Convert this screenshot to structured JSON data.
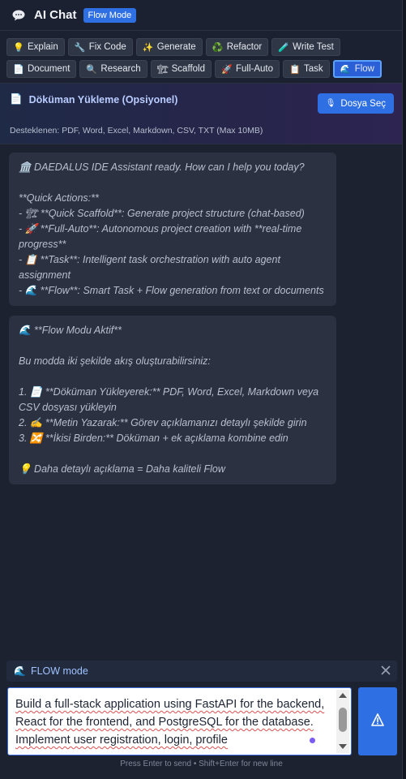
{
  "header": {
    "title": "AI Chat",
    "mode_badge": "Flow Mode",
    "icon": "chat-bubble-icon"
  },
  "toolbar": {
    "buttons": [
      {
        "icon": "💡",
        "label": "Explain"
      },
      {
        "icon": "🔧",
        "label": "Fix Code"
      },
      {
        "icon": "✨",
        "label": "Generate"
      },
      {
        "icon": "♻️",
        "label": "Refactor"
      },
      {
        "icon": "🧪",
        "label": "Write Test"
      },
      {
        "icon": "📄",
        "label": "Document"
      },
      {
        "icon": "🔍",
        "label": "Research"
      },
      {
        "icon": "🏗",
        "label": "Scaffold"
      },
      {
        "icon": "🚀",
        "label": "Full-Auto"
      },
      {
        "icon": "📋",
        "label": "Task"
      },
      {
        "icon": "🌊",
        "label": "Flow"
      }
    ],
    "active": "Flow"
  },
  "upload": {
    "icon": "📄",
    "title": "Döküman Yükleme (Opsiyonel)",
    "button_icon": "🎙",
    "button_label": "Dosya Seç",
    "supported": "Desteklenen: PDF, Word, Excel, Markdown, CSV, TXT (Max 10MB)"
  },
  "messages": [
    {
      "lines": [
        "🏛️ DAEDALUS IDE Assistant ready. How can I help you today?",
        "",
        "**Quick Actions:**",
        "- 🏗 **Quick Scaffold**: Generate project structure (chat-based)",
        "- 🚀 **Full-Auto**: Autonomous project creation with **real-time progress**",
        "- 📋 **Task**: Intelligent task orchestration with auto agent assignment",
        "- 🌊 **Flow**: Smart Task + Flow generation from text or documents"
      ]
    },
    {
      "lines": [
        "🌊 **Flow Modu Aktif**",
        "",
        "Bu modda iki şekilde akış oluşturabilirsiniz:",
        "",
        "1. 📄 **Döküman Yükleyerek:** PDF, Word, Excel, Markdown veya CSV dosyası yükleyin",
        "2. ✍️ **Metin Yazarak:** Görev açıklamanızı detaylı şekilde girin",
        "3. 🔀 **İkisi Birden:** Döküman + ek açıklama kombine edin",
        "",
        "💡 Daha detaylı açıklama = Daha kaliteli Flow"
      ]
    }
  ],
  "flow_bar": {
    "icon": "🌊",
    "label": "FLOW mode"
  },
  "input": {
    "value": "Build a full-stack application using FastAPI for the backend, React for the frontend, and PostgreSQL for the database. Implement user registration, login, profile"
  },
  "send_icon": "send-icon",
  "hint": "Press Enter to send • Shift+Enter for new line",
  "colors": {
    "accent": "#2f6fe4",
    "background": "#1c2230",
    "message_bg": "#2b3140"
  }
}
